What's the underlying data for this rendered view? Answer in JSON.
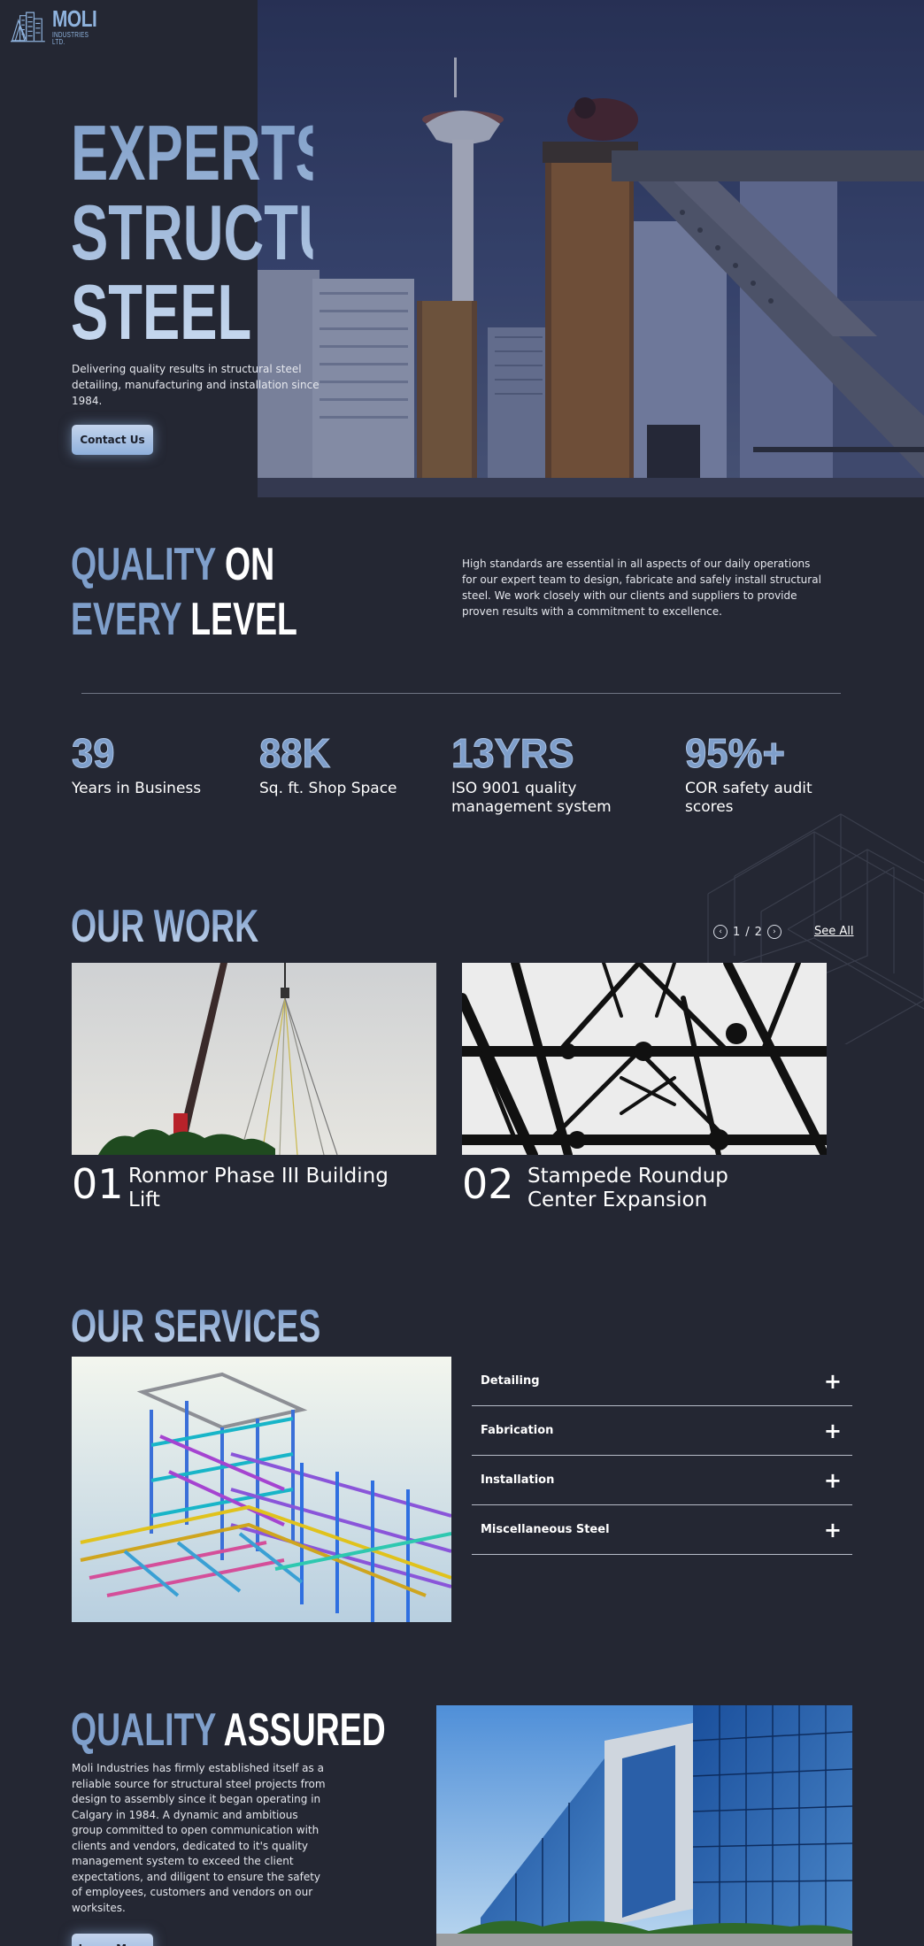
{
  "header": {
    "logo_name": "MOLI",
    "logo_sub": "INDUSTRIES LTD.",
    "menu_icon": "hamburger-menu-icon"
  },
  "hero": {
    "title_lines": [
      "EXPERTS IN",
      "STRUCTURAL",
      "STEEL"
    ],
    "description": "Delivering quality results in structural steel detailing, manufacturing and installation since 1984.",
    "cta": "Contact Us"
  },
  "quality": {
    "title_line1_accent": "QUALITY",
    "title_line1_rest": " ON",
    "title_line2_accent": "EVERY",
    "title_line2_rest": " LEVEL",
    "description": "High standards are essential in all aspects of our daily operations for our expert team to design, fabricate and safely install structural steel. We work closely with our clients and suppliers to provide proven results with a commitment to excellence."
  },
  "stats": [
    {
      "value": "39",
      "label_line1": "Years in Business",
      "label_line2": ""
    },
    {
      "value": "88K",
      "label_line1": "Sq. ft. Shop Space",
      "label_line2": ""
    },
    {
      "value": "13YRS",
      "label_line1": "ISO 9001 quality",
      "label_line2": "management system"
    },
    {
      "value": "95%+",
      "label_line1": "COR safety audit",
      "label_line2": "scores"
    }
  ],
  "work": {
    "title": "OUR WORK",
    "pager_current": "1",
    "pager_sep": "/",
    "pager_total": "2",
    "see_all": "See All",
    "projects": [
      {
        "num": "01",
        "name_line1": "Ronmor Phase III Building",
        "name_line2": "Lift"
      },
      {
        "num": "02",
        "name_line1": "Stampede Roundup",
        "name_line2": "Center Expansion"
      }
    ]
  },
  "services": {
    "title": "OUR SERVICES",
    "items": [
      "Detailing",
      "Fabrication",
      "Installation",
      "Miscellaneous Steel"
    ],
    "expand_symbol": "+"
  },
  "assured": {
    "title_accent": "QUALITY",
    "title_rest": " ASSURED",
    "description": "Moli Industries has firmly established itself as a reliable source for structural steel projects from design to assembly since it began operating in Calgary in 1984.  A dynamic and ambitious group committed to open communication with clients and vendors, dedicated to it's quality management system to exceed the client expectations, and diligent to ensure the safety of employees, customers and vendors on our worksites.",
    "cta": "Learn More"
  },
  "colors": {
    "background": "#242733",
    "accent": "#7f9fcb",
    "accent_light": "#c9daf0"
  }
}
